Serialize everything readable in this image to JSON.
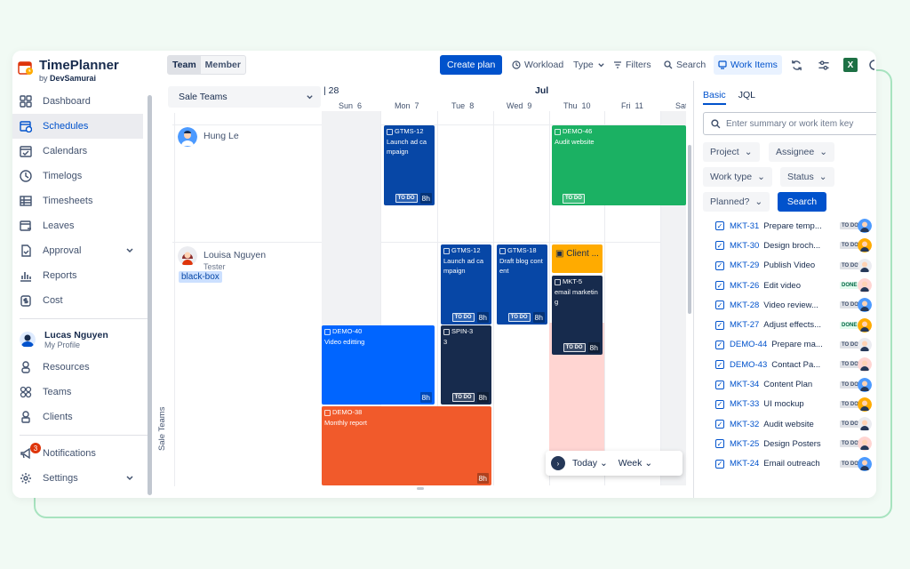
{
  "brand": {
    "name": "TimePlanner",
    "by_prefix": "by",
    "by_name": "DevSamurai"
  },
  "sidebar": {
    "items": [
      {
        "label": "Dashboard",
        "icon": "grid-icon"
      },
      {
        "label": "Schedules",
        "icon": "calendar-clock-icon",
        "active": true
      },
      {
        "label": "Calendars",
        "icon": "calendar-check-icon"
      },
      {
        "label": "Timelogs",
        "icon": "clock-icon"
      },
      {
        "label": "Timesheets",
        "icon": "table-icon"
      },
      {
        "label": "Leaves",
        "icon": "calendar-leave-icon"
      },
      {
        "label": "Approval",
        "icon": "approval-doc-icon",
        "expandable": true
      },
      {
        "label": "Reports",
        "icon": "bar-chart-icon"
      },
      {
        "label": "Cost",
        "icon": "dollar-icon"
      }
    ],
    "profile": {
      "name": "Lucas Nguyen",
      "sub": "My Profile"
    },
    "items2": [
      {
        "label": "Resources",
        "icon": "person-icon"
      },
      {
        "label": "Teams",
        "icon": "team-icon"
      },
      {
        "label": "Clients",
        "icon": "client-icon"
      }
    ],
    "notifications": {
      "label": "Notifications",
      "count": "3"
    },
    "settings": {
      "label": "Settings"
    }
  },
  "toolbar": {
    "team": "Team",
    "member": "Member",
    "create_plan": "Create plan",
    "workload": "Workload",
    "type": "Type",
    "filters": "Filters",
    "search": "Search",
    "work_items": "Work Items"
  },
  "team": {
    "selector": "Sale Teams",
    "vertical_label": "Sale Teams"
  },
  "people": [
    {
      "name": "Hung Le",
      "role": ""
    },
    {
      "name": "Louisa Nguyen",
      "role": "Tester",
      "tag": "black-box"
    }
  ],
  "calendar": {
    "prev_day": "28",
    "month": "Jul",
    "days": [
      {
        "dow": "Sun",
        "num": "6"
      },
      {
        "dow": "Mon",
        "num": "7"
      },
      {
        "dow": "Tue",
        "num": "8"
      },
      {
        "dow": "Wed",
        "num": "9"
      },
      {
        "dow": "Thu",
        "num": "10"
      },
      {
        "dow": "Fri",
        "num": "11"
      },
      {
        "dow": "Sat",
        "num": ""
      }
    ],
    "cards": [
      {
        "key": "GTMS-12",
        "title": "Launch ad campaign",
        "status": "TO DO",
        "hours": "8h",
        "color": "#0747a6"
      },
      {
        "key": "DEMO-46",
        "title": "Audit website",
        "status": "TO DO",
        "hours": "",
        "color": "#1bb163"
      },
      {
        "key": "GTMS-12",
        "title": "Launch ad campaign",
        "status": "TO DO",
        "hours": "8h",
        "color": "#0747a6"
      },
      {
        "key": "GTMS-18",
        "title": "Draft blog content",
        "status": "TO DO",
        "hours": "8h",
        "color": "#0747a6"
      },
      {
        "key": "",
        "title": "Client ...",
        "status": "",
        "hours": "",
        "color": "#ffab00"
      },
      {
        "key": "MKT-5",
        "title": "email marketing",
        "status": "TO DO",
        "hours": "8h",
        "color": "#172b4d"
      },
      {
        "key": "DEMO-40",
        "title": "Video editting",
        "status": "",
        "hours": "8h",
        "color": "#0065ff"
      },
      {
        "key": "SPIN-3",
        "title": "3",
        "status": "TO DO",
        "hours": "8h",
        "color": "#172b4d"
      },
      {
        "key": "DEMO-38",
        "title": "Monthly report",
        "status": "",
        "hours": "8h",
        "color": "#f15a2b"
      }
    ],
    "today": "Today",
    "range": "Week"
  },
  "panel": {
    "tabs": [
      "Basic",
      "JQL"
    ],
    "search_placeholder": "Enter summary or work item key",
    "filters": {
      "project": "Project",
      "assignee": "Assignee",
      "work_type": "Work type",
      "status": "Status",
      "planned": "Planned?"
    },
    "search_btn": "Search",
    "items": [
      {
        "key": "MKT-31",
        "title": "Prepare temp...",
        "status": "TO DO"
      },
      {
        "key": "MKT-30",
        "title": "Design broch...",
        "status": "TO DO"
      },
      {
        "key": "MKT-29",
        "title": "Publish Video",
        "status": "TO DO"
      },
      {
        "key": "MKT-26",
        "title": "Edit video",
        "status": "DONE"
      },
      {
        "key": "MKT-28",
        "title": "Video review...",
        "status": "TO DO"
      },
      {
        "key": "MKT-27",
        "title": "Adjust effects...",
        "status": "DONE"
      },
      {
        "key": "DEMO-44",
        "title": "Prepare ma...",
        "status": "TO DO"
      },
      {
        "key": "DEMO-43",
        "title": "Contact Pa...",
        "status": "TO DO"
      },
      {
        "key": "MKT-34",
        "title": "Content Plan",
        "status": "TO DO"
      },
      {
        "key": "MKT-33",
        "title": "UI mockup",
        "status": "TO DO"
      },
      {
        "key": "MKT-32",
        "title": "Audit website",
        "status": "TO DO"
      },
      {
        "key": "MKT-25",
        "title": "Design Posters",
        "status": "TO DO"
      },
      {
        "key": "MKT-24",
        "title": "Email outreach",
        "status": "TO DO"
      }
    ]
  }
}
